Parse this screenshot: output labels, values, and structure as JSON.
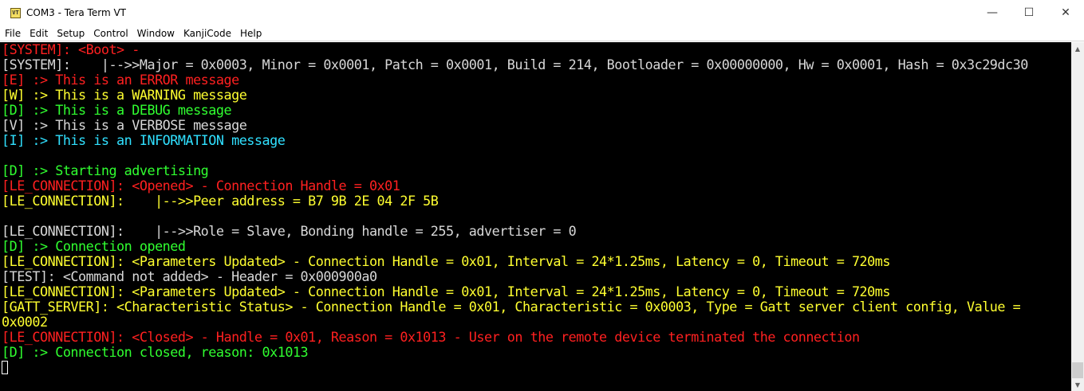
{
  "window": {
    "title": "COM3 - Tera Term VT",
    "icon_text": "VT",
    "controls": {
      "minimize": "—",
      "maximize": "☐",
      "close": "✕"
    }
  },
  "menu": [
    "File",
    "Edit",
    "Setup",
    "Control",
    "Window",
    "KanjiCode",
    "Help"
  ],
  "colors": {
    "red": "#ff2020",
    "yellow": "#ffff30",
    "green": "#30ff30",
    "white": "#d8d8d8",
    "cyan": "#30e0ff"
  },
  "terminal": {
    "lines": [
      {
        "text": "[SYSTEM]: <Boot> -",
        "color": "red"
      },
      {
        "text": "[SYSTEM]:    |-->>Major = 0x0003, Minor = 0x0001, Patch = 0x0001, Build = 214, Bootloader = 0x00000000, Hw = 0x0001, Hash = 0x3c29dc30",
        "color": "white"
      },
      {
        "text": "[E] :> This is an ERROR message",
        "color": "red"
      },
      {
        "text": "[W] :> This is a WARNING message",
        "color": "yellow"
      },
      {
        "text": "[D] :> This is a DEBUG message",
        "color": "green"
      },
      {
        "text": "[V] :> This is a VERBOSE message",
        "color": "white"
      },
      {
        "text": "[I] :> This is an INFORMATION message",
        "color": "cyan"
      },
      {
        "text": "",
        "color": "white"
      },
      {
        "text": "[D] :> Starting advertising",
        "color": "green"
      },
      {
        "text": "[LE_CONNECTION]: <Opened> - Connection Handle = 0x01",
        "color": "red"
      },
      {
        "text": "[LE_CONNECTION]:    |-->>Peer address = B7 9B 2E 04 2F 5B",
        "color": "yellow"
      },
      {
        "text": "",
        "color": "white"
      },
      {
        "text": "[LE_CONNECTION]:    |-->>Role = Slave, Bonding handle = 255, advertiser = 0",
        "color": "white"
      },
      {
        "text": "[D] :> Connection opened",
        "color": "green"
      },
      {
        "text": "[LE_CONNECTION]: <Parameters Updated> - Connection Handle = 0x01, Interval = 24*1.25ms, Latency = 0, Timeout = 720ms",
        "color": "yellow"
      },
      {
        "text": "[TEST]: <Command not added> - Header = 0x000900a0",
        "color": "white"
      },
      {
        "text": "[LE_CONNECTION]: <Parameters Updated> - Connection Handle = 0x01, Interval = 24*1.25ms, Latency = 0, Timeout = 720ms",
        "color": "yellow"
      },
      {
        "text": "[GATT_SERVER]: <Characteristic Status> - Connection Handle = 0x01, Characteristic = 0x0003, Type = Gatt server client config, Value =",
        "color": "yellow"
      },
      {
        "text": "0x0002",
        "color": "yellow"
      },
      {
        "text": "[LE_CONNECTION]: <Closed> - Handle = 0x01, Reason = 0x1013 - User on the remote device terminated the connection",
        "color": "red"
      },
      {
        "text": "[D] :> Connection closed, reason: 0x1013",
        "color": "green"
      }
    ]
  },
  "scrollbar": {
    "up_arrow": "▲",
    "down_arrow": "▼"
  }
}
